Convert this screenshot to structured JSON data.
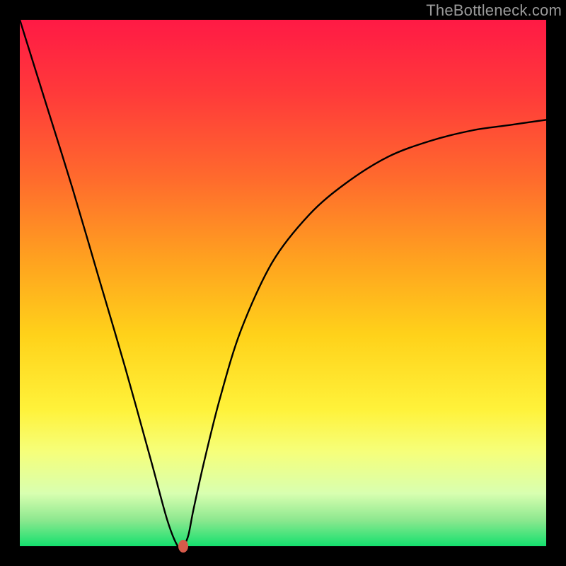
{
  "watermark": "TheBottleneck.com",
  "colors": {
    "frame": "#000000",
    "curve": "#000000",
    "dot": "#d65a4a",
    "gradient_top": "#ff1a45",
    "gradient_bottom": "#14e06e"
  },
  "chart_data": {
    "type": "line",
    "title": "",
    "xlabel": "",
    "ylabel": "",
    "xlim": [
      0,
      100
    ],
    "ylim": [
      0,
      100
    ],
    "series": [
      {
        "name": "curve",
        "x": [
          0,
          5,
          10,
          15,
          20,
          25,
          28,
          30,
          31,
          32,
          33,
          35,
          38,
          42,
          48,
          55,
          62,
          70,
          78,
          86,
          93,
          100
        ],
        "values": [
          100,
          84,
          68,
          51,
          34,
          16,
          5,
          0,
          0,
          2,
          7,
          16,
          28,
          41,
          54,
          63,
          69,
          74,
          77,
          79,
          80,
          81
        ]
      }
    ],
    "marker": {
      "x": 31,
      "y": 0
    },
    "grid": false,
    "legend": false
  }
}
